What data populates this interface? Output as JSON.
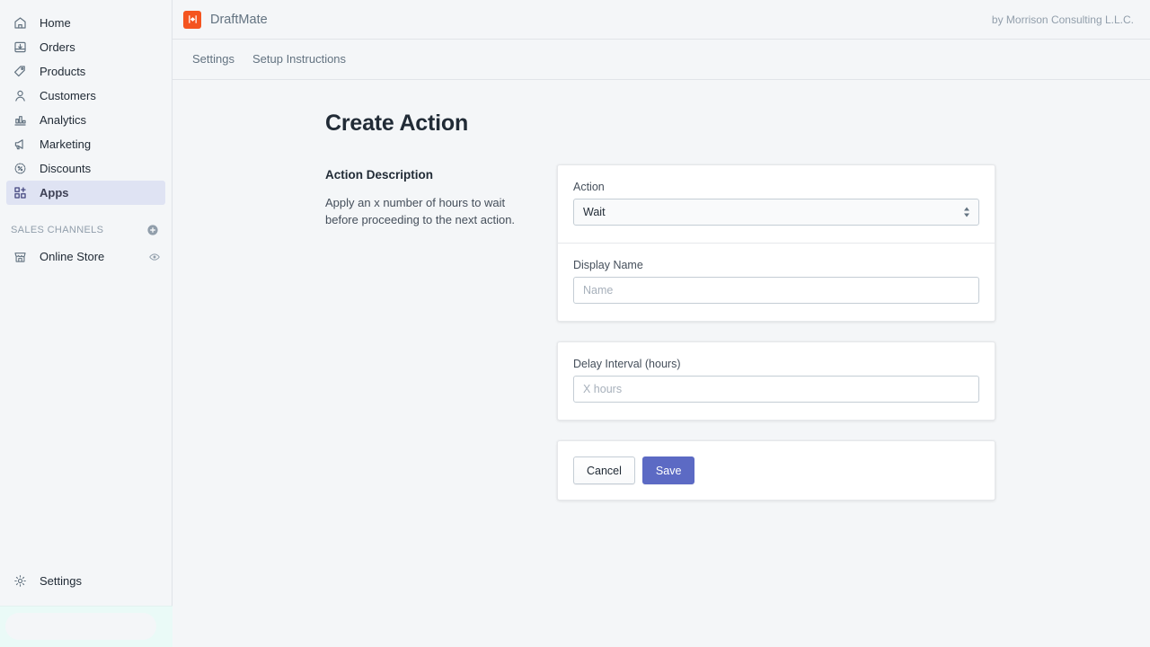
{
  "sidebar": {
    "nav_items": [
      {
        "label": "Home",
        "icon": "home-icon",
        "active": false
      },
      {
        "label": "Orders",
        "icon": "orders-icon",
        "active": false
      },
      {
        "label": "Products",
        "icon": "products-tag-icon",
        "active": false
      },
      {
        "label": "Customers",
        "icon": "customers-person-icon",
        "active": false
      },
      {
        "label": "Analytics",
        "icon": "analytics-bar-chart-icon",
        "active": false
      },
      {
        "label": "Marketing",
        "icon": "marketing-megaphone-icon",
        "active": false
      },
      {
        "label": "Discounts",
        "icon": "discounts-percent-badge-icon",
        "active": false
      },
      {
        "label": "Apps",
        "icon": "apps-grid-plus-icon",
        "active": true
      }
    ],
    "sales_channels": {
      "header": "SALES CHANNELS",
      "add_icon": "circle-plus-icon",
      "items": [
        {
          "label": "Online Store",
          "icon": "online-store-icon",
          "trailing_icon": "eye-icon"
        }
      ]
    },
    "settings": {
      "label": "Settings",
      "icon": "gear-icon"
    }
  },
  "topbar": {
    "logo_icon": "draftmate-logo-icon",
    "logo_color": "#f4541f",
    "app_name": "DraftMate",
    "byline": "by Morrison Consulting L.L.C."
  },
  "tabs": [
    {
      "label": "Settings"
    },
    {
      "label": "Setup Instructions"
    }
  ],
  "page": {
    "title": "Create Action",
    "description_heading": "Action Description",
    "description_body": "Apply an x number of hours to wait before proceeding to the next action."
  },
  "form": {
    "action": {
      "label": "Action",
      "value": "Wait",
      "options": [
        "Wait"
      ],
      "stepper_icon": "select-chevrons-icon"
    },
    "display_name": {
      "label": "Display Name",
      "value": "",
      "placeholder": "Name"
    },
    "delay_interval": {
      "label": "Delay Interval (hours)",
      "value": "",
      "placeholder": "X hours"
    }
  },
  "actions": {
    "cancel_label": "Cancel",
    "save_label": "Save",
    "save_color": "#5c6ac4"
  }
}
